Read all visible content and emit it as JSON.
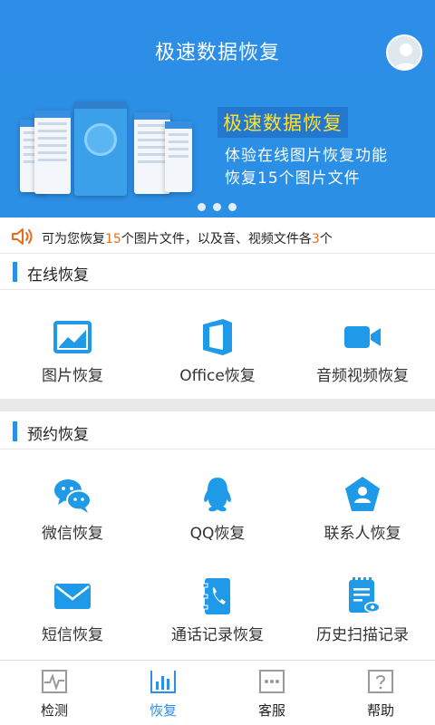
{
  "header": {
    "title": "极速数据恢复"
  },
  "banner": {
    "title": "极速数据恢复",
    "line1": "体验在线图片恢复功能",
    "line2": "恢复15个图片文件",
    "page_count": 3,
    "active_page": 0
  },
  "notice": {
    "prefix": "可为您恢复",
    "image_count": "15",
    "middle": "个图片文件，以及音、视频文件各",
    "av_count": "3",
    "suffix": "个"
  },
  "online_section": {
    "title": "在线恢复",
    "items": [
      {
        "label": "图片恢复",
        "icon": "image-icon"
      },
      {
        "label": "Office恢复",
        "icon": "office-icon"
      },
      {
        "label": "音频视频恢复",
        "icon": "video-camera-icon"
      }
    ]
  },
  "reserve_section": {
    "title": "预约恢复",
    "items": [
      {
        "label": "微信恢复",
        "icon": "wechat-icon"
      },
      {
        "label": "QQ恢复",
        "icon": "qq-icon"
      },
      {
        "label": "联系人恢复",
        "icon": "contact-icon"
      },
      {
        "label": "短信恢复",
        "icon": "envelope-icon"
      },
      {
        "label": "通话记录恢复",
        "icon": "call-log-icon"
      },
      {
        "label": "历史扫描记录",
        "icon": "scan-history-icon"
      }
    ]
  },
  "tabbar": {
    "active": 1,
    "tabs": [
      {
        "label": "检测",
        "icon": "heartbeat-icon"
      },
      {
        "label": "恢复",
        "icon": "bar-chart-icon"
      },
      {
        "label": "客服",
        "icon": "chat-dots-icon"
      },
      {
        "label": "帮助",
        "icon": "question-icon"
      }
    ]
  },
  "colors": {
    "brand_blue": "#2d8ee8",
    "banner_title": "#ffe02e",
    "highlight_number": "#f06a1a",
    "icon_blue": "#1f9ae8"
  }
}
